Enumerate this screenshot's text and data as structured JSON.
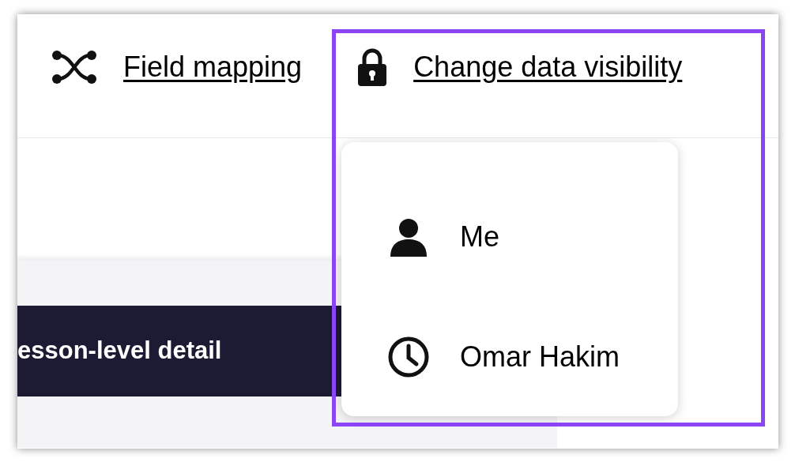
{
  "toolbar": {
    "links": [
      {
        "kind": "shuffle",
        "label": "Field mapping"
      },
      {
        "kind": "lock",
        "label": "Change data visibility"
      }
    ]
  },
  "banner": {
    "text": "esson-level detail"
  },
  "menu": {
    "highlighted": true,
    "items": [
      {
        "kind": "person",
        "label": "Me"
      },
      {
        "kind": "clock",
        "label": "Omar Hakim"
      }
    ]
  }
}
